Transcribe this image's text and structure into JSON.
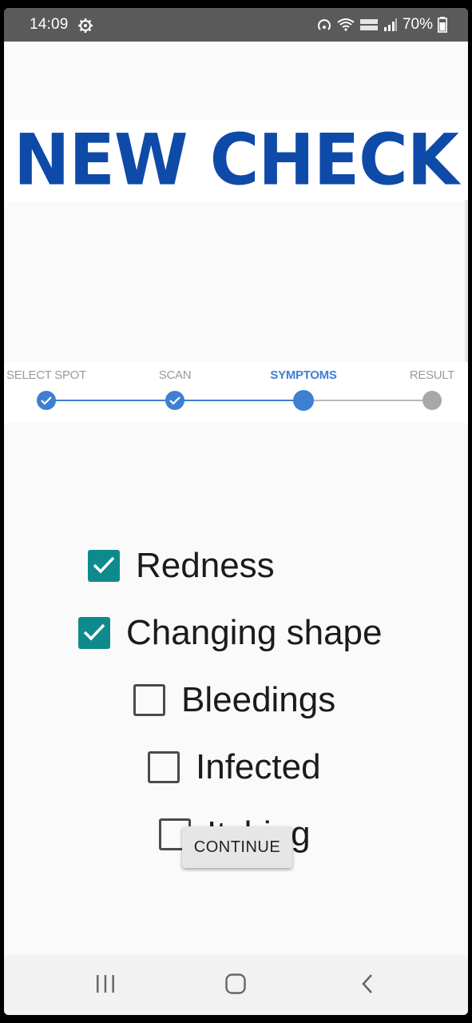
{
  "status_bar": {
    "time": "14:09",
    "battery": "70%",
    "icons": [
      "settings-gear-icon",
      "hotspot-icon",
      "wifi-call-icon",
      "volte-icon",
      "signal-icon",
      "battery-icon"
    ]
  },
  "header": {
    "title": "NEW CHECK",
    "title_color": "#0e4aa8"
  },
  "stepper": {
    "steps": [
      {
        "label": "SELECT SPOT",
        "state": "done"
      },
      {
        "label": "SCAN",
        "state": "done"
      },
      {
        "label": "SYMPTOMS",
        "state": "active"
      },
      {
        "label": "RESULT",
        "state": "pending"
      }
    ],
    "done_color": "#3f7fd2",
    "pending_color": "#a8a8a8"
  },
  "symptoms": [
    {
      "label": "Redness",
      "checked": true
    },
    {
      "label": "Changing shape",
      "checked": true
    },
    {
      "label": "Bleedings",
      "checked": false
    },
    {
      "label": "Infected",
      "checked": false
    },
    {
      "label": "Itching",
      "checked": false
    }
  ],
  "checkbox_color": "#0f8a8c",
  "continue_button": {
    "label": "CONTINUE"
  },
  "nav_bar": {
    "icons": [
      "recents-icon",
      "home-icon",
      "back-icon"
    ]
  }
}
